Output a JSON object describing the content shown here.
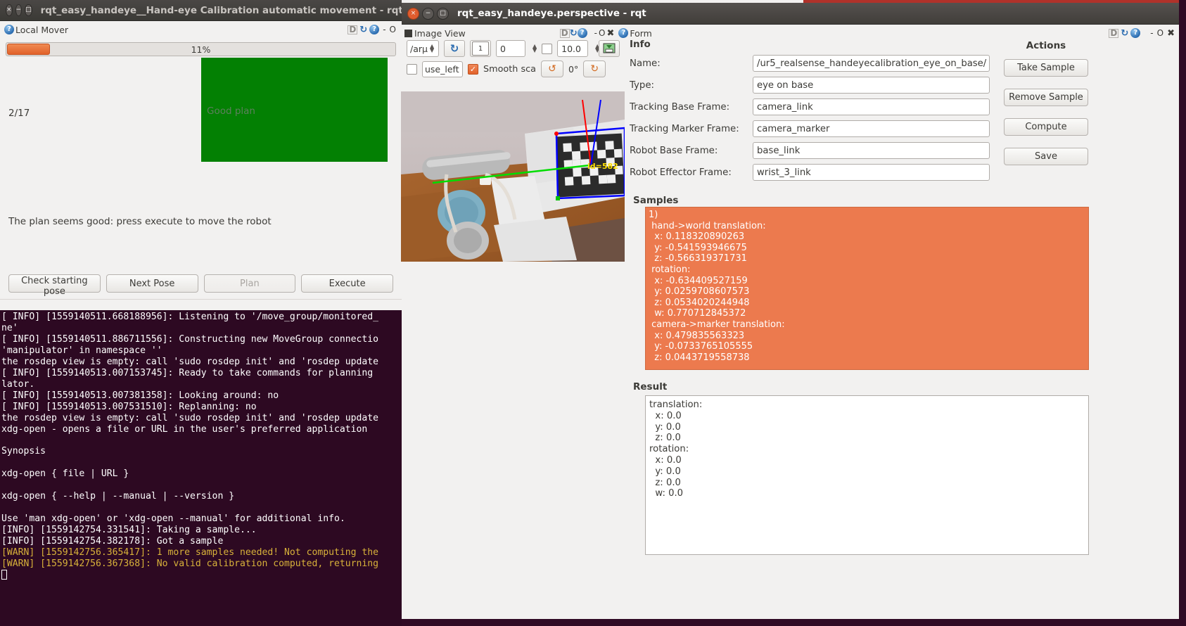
{
  "left_window": {
    "title": "rqt_easy_handeye__Hand-eye Calibration automatic movement - rqt",
    "window_buttons": {
      "close": "×",
      "minimize": "−",
      "maximize": "□"
    },
    "plugin": {
      "title": "Local Mover",
      "help_icon": "?",
      "dock_d": "D",
      "dock_reload": "↻",
      "dock_help": "?",
      "minimize": "-",
      "restore": "O"
    },
    "progress": {
      "percent_label": "11%",
      "value": 11
    },
    "counter": "2/17",
    "plan_box_text": "Good plan",
    "plan_box_color": "#038003",
    "status_message": "The plan seems good: press execute to move the robot",
    "buttons": [
      {
        "label": "Check starting pose",
        "disabled": false
      },
      {
        "label": "Next Pose",
        "disabled": false
      },
      {
        "label": "Plan",
        "disabled": true
      },
      {
        "label": "Execute",
        "disabled": false
      }
    ]
  },
  "terminal": {
    "lines": [
      {
        "text": "[ INFO] [1559140511.668188956]: Listening to '/move_group/monitored_",
        "warn": false
      },
      {
        "text": "ne'",
        "warn": false
      },
      {
        "text": "[ INFO] [1559140511.886711556]: Constructing new MoveGroup connectio",
        "warn": false
      },
      {
        "text": "'manipulator' in namespace ''",
        "warn": false
      },
      {
        "text": "the rosdep view is empty: call 'sudo rosdep init' and 'rosdep update",
        "warn": false
      },
      {
        "text": "[ INFO] [1559140513.007153745]: Ready to take commands for planning ",
        "warn": false
      },
      {
        "text": "lator.",
        "warn": false
      },
      {
        "text": "[ INFO] [1559140513.007381358]: Looking around: no",
        "warn": false
      },
      {
        "text": "[ INFO] [1559140513.007531510]: Replanning: no",
        "warn": false
      },
      {
        "text": "the rosdep view is empty: call 'sudo rosdep init' and 'rosdep update",
        "warn": false
      },
      {
        "text": "xdg-open - opens a file or URL in the user's preferred application",
        "warn": false
      },
      {
        "text": "",
        "warn": false
      },
      {
        "text": "Synopsis",
        "warn": false
      },
      {
        "text": "",
        "warn": false
      },
      {
        "text": "xdg-open { file | URL }",
        "warn": false
      },
      {
        "text": "",
        "warn": false
      },
      {
        "text": "xdg-open { --help | --manual | --version }",
        "warn": false
      },
      {
        "text": "",
        "warn": false
      },
      {
        "text": "Use 'man xdg-open' or 'xdg-open --manual' for additional info.",
        "warn": false
      },
      {
        "text": "[INFO] [1559142754.331541]: Taking a sample...",
        "warn": false
      },
      {
        "text": "[INFO] [1559142754.382178]: Got a sample",
        "warn": false
      },
      {
        "text": "[WARN] [1559142756.365417]: 1 more samples needed! Not computing the",
        "warn": true
      },
      {
        "text": "[WARN] [1559142756.367368]: No valid calibration computed, returning",
        "warn": true
      }
    ]
  },
  "right_window": {
    "title": "rqt_easy_handeye.perspective - rqt",
    "plugins": [
      {
        "label": "Image View",
        "icon": "image-view-icon"
      },
      {
        "label": "Form",
        "icon": "help-icon"
      }
    ],
    "dock_d": "D",
    "dock_reload": "↻",
    "dock_help": "?",
    "dock_minimize": "-",
    "dock_restore": "O",
    "dock_close": "✖",
    "image_view": {
      "topic_value": "/arµ",
      "refresh_icon": "↻",
      "index_value": "1",
      "number_value": "0",
      "dynamic_range_checked": false,
      "max_range_value": "10.0",
      "save_icon": "save-image-icon",
      "publish_checked": false,
      "mouse_topic_value": "use_left",
      "smooth_scaling_label": "Smooth sca",
      "smooth_scaling_checked": true,
      "rotate_left_icon": "↺",
      "rotation_label": "0°",
      "rotate_right_icon": "↻",
      "marker_label": "id=582"
    },
    "info": {
      "heading": "Info",
      "fields": [
        {
          "label": "Name:",
          "value": "/ur5_realsense_handeyecalibration_eye_on_base/"
        },
        {
          "label": "Type:",
          "value": "eye on base"
        },
        {
          "label": "Tracking Base Frame:",
          "value": "camera_link"
        },
        {
          "label": "Tracking Marker Frame:",
          "value": "camera_marker"
        },
        {
          "label": "Robot Base Frame:",
          "value": "base_link"
        },
        {
          "label": "Robot Effector Frame:",
          "value": "wrist_3_link"
        }
      ]
    },
    "samples": {
      "heading": "Samples",
      "background_color": "#ec7a4e",
      "text": "1)\n hand->world translation:\n  x: 0.118320890263\n  y: -0.541593946675\n  z: -0.566319371731\n rotation:\n  x: -0.634409527159\n  y: 0.0259708607573\n  z: 0.0534020244948\n  w: 0.770712845372\n camera->marker translation:\n  x: 0.479835563323\n  y: -0.0733765105555\n  z: 0.0443719558738"
    },
    "result": {
      "heading": "Result",
      "text": "translation:\n  x: 0.0\n  y: 0.0\n  z: 0.0\nrotation:\n  x: 0.0\n  y: 0.0\n  z: 0.0\n  w: 0.0"
    },
    "actions": {
      "heading": "Actions",
      "buttons": [
        {
          "label": "Take Sample"
        },
        {
          "label": "Remove Sample"
        },
        {
          "label": "Compute"
        },
        {
          "label": "Save"
        }
      ]
    }
  }
}
